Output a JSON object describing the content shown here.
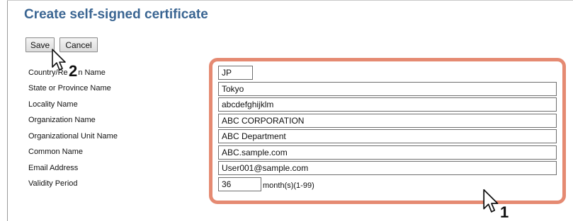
{
  "page": {
    "title": "Create self-signed certificate"
  },
  "toolbar": {
    "save_label": "Save",
    "cancel_label": "Cancel"
  },
  "form": {
    "country_label": "Country/Region Name",
    "country_value": "JP",
    "state_label": "State or Province Name",
    "state_value": "Tokyo",
    "locality_label": "Locality Name",
    "locality_value": "abcdefghijklm",
    "org_label": "Organization Name",
    "org_value": "ABC CORPORATION",
    "org_unit_label": "Organizational Unit Name",
    "org_unit_value": "ABC Department",
    "common_label": "Common Name",
    "common_value": "ABC.sample.com",
    "email_label": "Email Address",
    "email_value": "User001@sample.com",
    "validity_label": "Validity Period",
    "validity_value": "36",
    "validity_unit": "month(s)(1-99)"
  },
  "annotations": {
    "callout_1": "1",
    "callout_2": "2",
    "highlight_color": "#e58a72"
  }
}
